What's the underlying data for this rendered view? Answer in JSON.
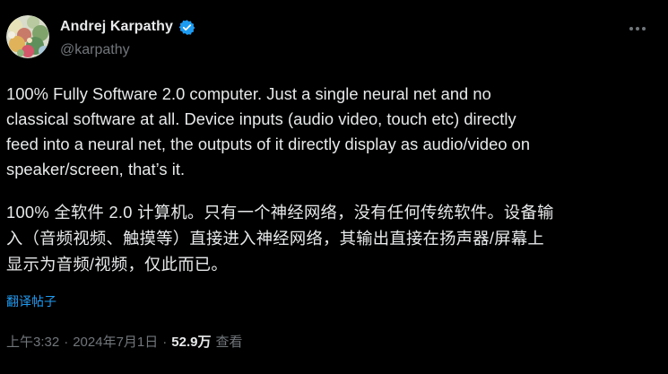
{
  "author": {
    "display_name": "Andrej Karpathy",
    "handle": "@karpathy",
    "verified": true
  },
  "icons": {
    "verified": "verified-badge-icon",
    "more": "more-options-icon"
  },
  "tweet": {
    "text_en": "100% Fully Software 2.0 computer. Just a single neural net and no\nclassical software at all. Device inputs (audio video, touch etc) directly\nfeed into a neural net, the outputs of it directly display as audio/video on\nspeaker/screen, that’s it.",
    "text_zh": "100% 全软件 2.0 计算机。只有一个神经网络，没有任何传统软件。设备输\n入（音频视频、触摸等）直接进入神经网络，其输出直接在扬声器/屏幕上\n显示为音频/视频，仅此而已。",
    "translate_label": "翻译帖子"
  },
  "meta": {
    "time": "上午3:32",
    "separator": "·",
    "date": "2024年7月1日",
    "views_count": "52.9万",
    "views_label": "查看"
  },
  "colors": {
    "background": "#000000",
    "text": "#e7e9ea",
    "secondary": "#71767b",
    "accent": "#1d9bf0"
  }
}
